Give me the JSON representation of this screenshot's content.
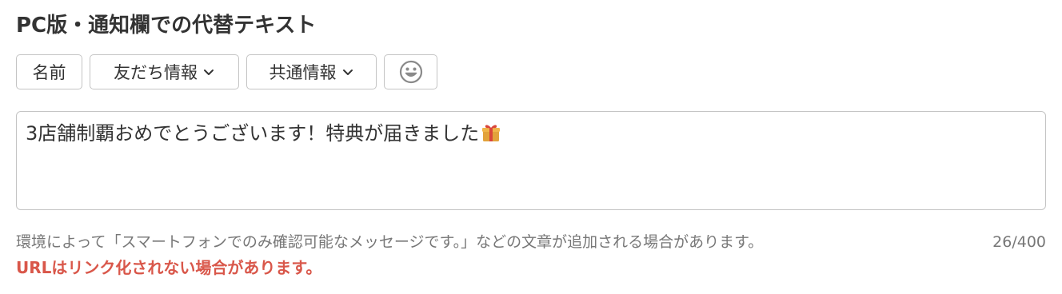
{
  "section": {
    "title": "PC版・通知欄での代替テキスト"
  },
  "toolbar": {
    "name_label": "名前",
    "friend_info_label": "友だち情報",
    "common_info_label": "共通情報",
    "friend_info_icon": "chevron-down-icon",
    "common_info_icon": "chevron-down-icon",
    "emoji_icon": "smiley-face-icon"
  },
  "editor": {
    "value": "3店舗制覇おめでとうございます！特典が届きました",
    "trailing_emoji": "gift-icon"
  },
  "help": {
    "text": "環境によって「スマートフォンでのみ確認可能なメッセージです。」などの文章が追加される場合があります。",
    "counter": "26/400"
  },
  "warning": {
    "text": "URLはリンク化されない場合があります。"
  },
  "colors": {
    "text": "#333333",
    "muted": "#777777",
    "border": "#c4c4c4",
    "warning": "#d9574a"
  }
}
